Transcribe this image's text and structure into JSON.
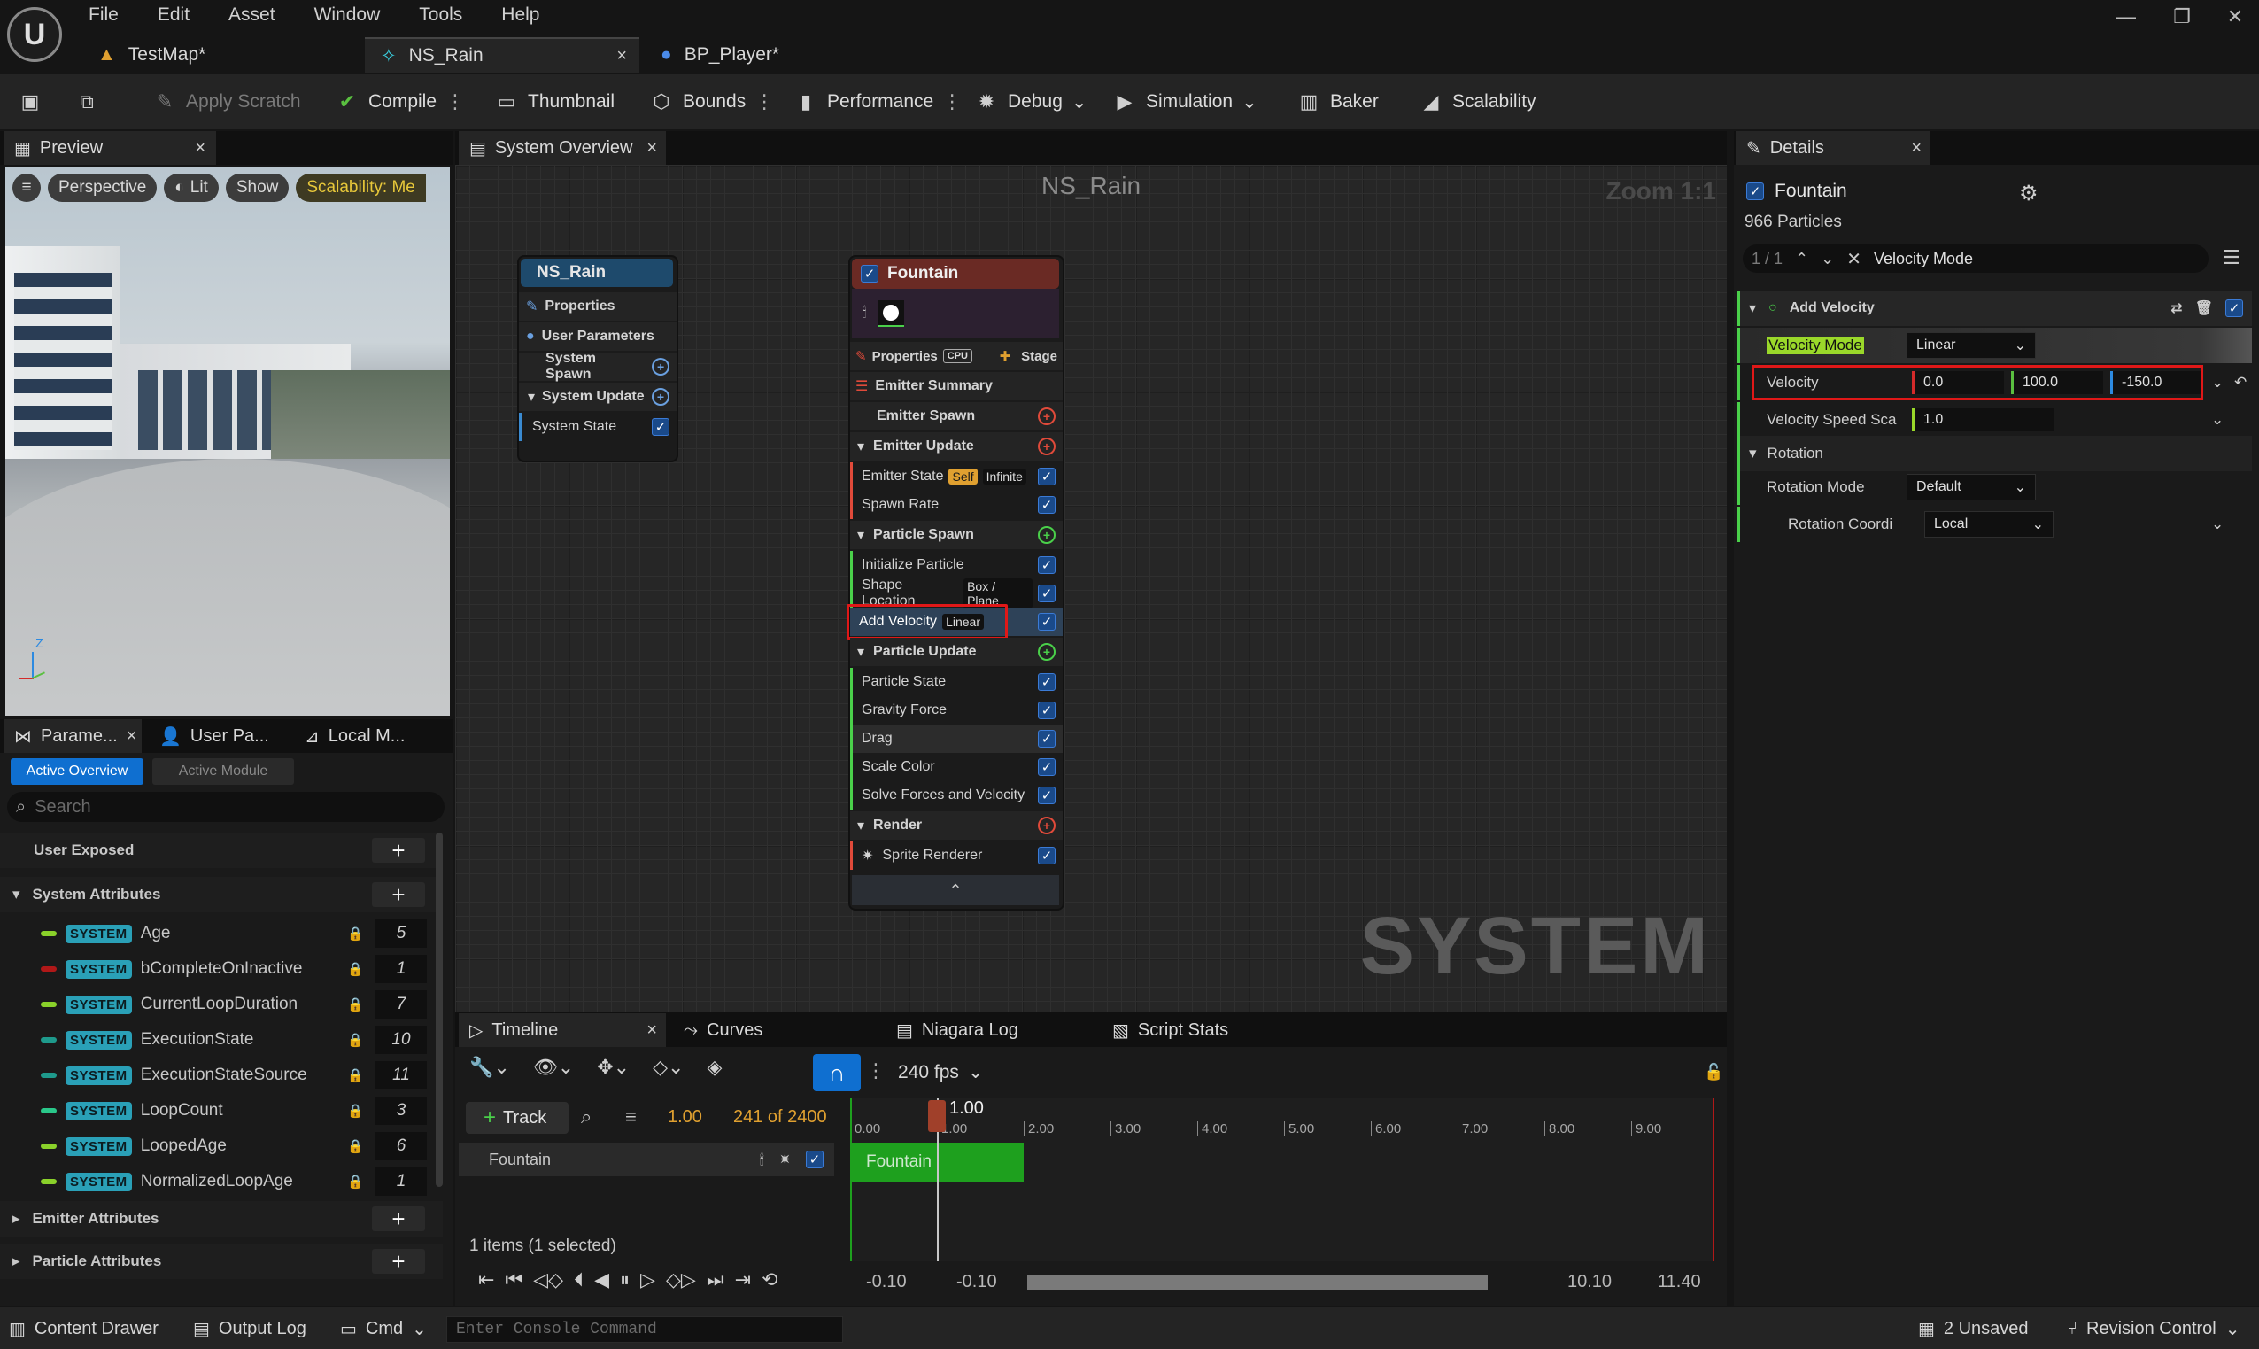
{
  "menu": [
    "File",
    "Edit",
    "Asset",
    "Window",
    "Tools",
    "Help"
  ],
  "window_controls": {
    "minimize": "—",
    "restore": "❐",
    "close": "✕"
  },
  "doc_tabs": [
    {
      "label": "TestMap*",
      "icon": "level-icon"
    },
    {
      "label": "NS_Rain",
      "icon": "niagara-system-icon",
      "close": "×"
    },
    {
      "label": "BP_Player*",
      "icon": "blueprint-icon"
    }
  ],
  "toolbar": {
    "apply_scratch": "Apply Scratch",
    "compile": "Compile",
    "thumbnail": "Thumbnail",
    "bounds": "Bounds",
    "performance": "Performance",
    "debug": "Debug",
    "simulation": "Simulation",
    "baker": "Baker",
    "scalability": "Scalability"
  },
  "preview": {
    "tab": "Preview",
    "perspective": "Perspective",
    "lit": "Lit",
    "show": "Show",
    "scalability": "Scalability: Me",
    "axis_z": "Z"
  },
  "params_tabs": [
    "Parame...",
    "User Pa...",
    "Local M..."
  ],
  "params_subtabs": {
    "active": "Active Overview",
    "inactive": "Active Module"
  },
  "params_search": "Search",
  "params": {
    "user_exposed": "User Exposed",
    "system_attributes": "System Attributes",
    "badge": "SYSTEM",
    "rows": [
      {
        "name": "Age",
        "count": "5",
        "color": "#8ad12a"
      },
      {
        "name": "bCompleteOnInactive",
        "count": "1",
        "color": "#b01818"
      },
      {
        "name": "CurrentLoopDuration",
        "count": "7",
        "color": "#8ad12a"
      },
      {
        "name": "ExecutionState",
        "count": "10",
        "color": "#1e9a8c"
      },
      {
        "name": "ExecutionStateSource",
        "count": "11",
        "color": "#1e9a8c"
      },
      {
        "name": "LoopCount",
        "count": "3",
        "color": "#2ac88a"
      },
      {
        "name": "LoopedAge",
        "count": "6",
        "color": "#8ad12a"
      },
      {
        "name": "NormalizedLoopAge",
        "count": "1",
        "color": "#8ad12a"
      }
    ],
    "emitter_attributes": "Emitter Attributes",
    "particle_attributes": "Particle Attributes"
  },
  "graph": {
    "tab": "System Overview",
    "title": "NS_Rain",
    "zoom": "Zoom 1:1",
    "watermark": "SYSTEM",
    "system_node": {
      "title": "NS_Rain",
      "rows": [
        "Properties",
        "User Parameters",
        "System Spawn",
        "System Update",
        "System State"
      ]
    },
    "emitter_node": {
      "title": "Fountain",
      "properties": "Properties",
      "cpu": "CPU",
      "stage": "Stage",
      "emitter_summary": "Emitter Summary",
      "emitter_spawn": "Emitter Spawn",
      "emitter_update": "Emitter Update",
      "emitter_state": "Emitter State",
      "self_tag": "Self",
      "infinite_tag": "Infinite",
      "spawn_rate": "Spawn Rate",
      "particle_spawn": "Particle Spawn",
      "initialize_particle": "Initialize Particle",
      "shape_location": "Shape Location",
      "box_plane_tag": "Box / Plane",
      "add_velocity": "Add Velocity",
      "linear_tag": "Linear",
      "particle_update": "Particle Update",
      "particle_state": "Particle State",
      "gravity_force": "Gravity Force",
      "drag": "Drag",
      "scale_color": "Scale Color",
      "solve_forces": "Solve Forces and Velocity",
      "render": "Render",
      "sprite_renderer": "Sprite Renderer"
    }
  },
  "details": {
    "tab": "Details",
    "emitter_name": "Fountain",
    "particles": "966 Particles",
    "search_count": "1 / 1",
    "search_text": "Velocity Mode",
    "section": "Add Velocity",
    "velocity_mode_label": "Velocity Mode",
    "velocity_mode_value": "Linear",
    "velocity_label": "Velocity",
    "velocity_x": "0.0",
    "velocity_y": "100.0",
    "velocity_z": "-150.0",
    "speed_scale_label": "Velocity Speed Sca",
    "speed_scale_value": "1.0",
    "rotation_section": "Rotation",
    "rotation_mode_label": "Rotation Mode",
    "rotation_mode_value": "Default",
    "rotation_coord_label": "Rotation Coordi",
    "rotation_coord_value": "Local"
  },
  "timeline": {
    "tabs": [
      "Timeline",
      "Curves",
      "Niagara Log",
      "Script Stats"
    ],
    "fps": "240 fps",
    "track_button": "Track",
    "current_time": "1.00",
    "frame": "241 of 2400",
    "track_name": "Fountain",
    "clip_label": "Fountain",
    "playhead": "1.00",
    "ruler": [
      "0.00",
      "1.00",
      "2.00",
      "3.00",
      "4.00",
      "5.00",
      "6.00",
      "7.00",
      "8.00",
      "9.00"
    ],
    "items": "1 items (1 selected)",
    "range_start_a": "-0.10",
    "range_start_b": "-0.10",
    "range_end_a": "10.10",
    "range_end_b": "11.40"
  },
  "statusbar": {
    "content_drawer": "Content Drawer",
    "output_log": "Output Log",
    "cmd": "Cmd",
    "console_placeholder": "Enter Console Command",
    "unsaved": "2 Unsaved",
    "revision_control": "Revision Control"
  }
}
